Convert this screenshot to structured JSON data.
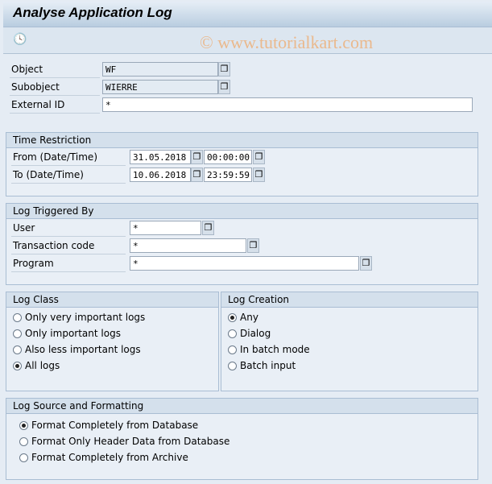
{
  "title": "Analyse Application Log",
  "toolbar": {
    "execute_icon": "clock-check-icon",
    "watermark": "© www.tutorialkart.com"
  },
  "fields": {
    "object": {
      "label": "Object",
      "value": "WF"
    },
    "subobject": {
      "label": "Subobject",
      "value": "WIERRE"
    },
    "external_id": {
      "label": "External ID",
      "value": "*"
    }
  },
  "time": {
    "title": "Time Restriction",
    "from_label": "From (Date/Time)",
    "from_date": "31.05.2018",
    "from_time": "00:00:00",
    "to_label": "To (Date/Time)",
    "to_date": "10.06.2018",
    "to_time": "23:59:59"
  },
  "trig": {
    "title": "Log Triggered By",
    "user_label": "User",
    "user": "*",
    "tcode_label": "Transaction code",
    "tcode": "*",
    "program_label": "Program",
    "program": "*"
  },
  "logclass": {
    "title": "Log Class",
    "options": [
      "Only very important logs",
      "Only important logs",
      "Also less important logs",
      "All logs"
    ],
    "selected": 3
  },
  "creation": {
    "title": "Log Creation",
    "options": [
      "Any",
      "Dialog",
      "In batch mode",
      "Batch input"
    ],
    "selected": 0
  },
  "source": {
    "title": "Log Source and Formatting",
    "options": [
      "Format Completely from Database",
      "Format Only Header Data from Database",
      "Format Completely from Archive"
    ],
    "selected": 0
  }
}
